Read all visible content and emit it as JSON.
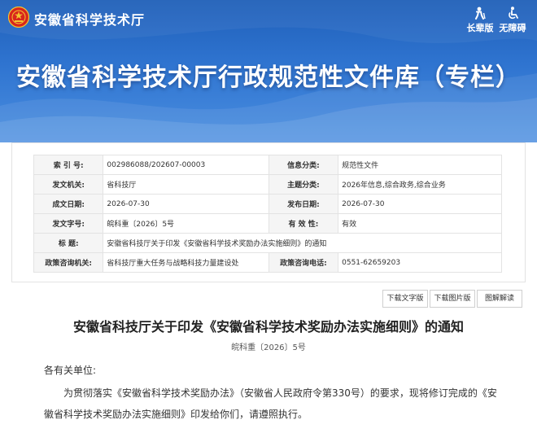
{
  "header": {
    "site_name": "安徽省科学技术厅",
    "elder_mode_label": "长辈版",
    "accessibility_label": "无障碍",
    "banner_title": "安徽省科学技术厅行政规范性文件库（专栏）"
  },
  "meta": {
    "rows": [
      {
        "k1": "索 引 号:",
        "v1": "002986088/202607-00003",
        "k2": "信息分类:",
        "v2": "规范性文件"
      },
      {
        "k1": "发文机关:",
        "v1": "省科技厅",
        "k2": "主题分类:",
        "v2": "2026年信息,综合政务,综合业务"
      },
      {
        "k1": "成文日期:",
        "v1": "2026-07-30",
        "k2": "发布日期:",
        "v2": "2026-07-30"
      },
      {
        "k1": "发文字号:",
        "v1": "皖科重〔2026〕5号",
        "k2": "有 效 性:",
        "v2": "有效"
      }
    ],
    "title_label": "标 题:",
    "title_value": "安徽省科技厅关于印发《安徽省科学技术奖励办法实施细则》的通知",
    "consult_org_label": "政策咨询机关:",
    "consult_org_value": "省科技厅重大任务与战略科技力量建设处",
    "consult_phone_label": "政策咨询电话:",
    "consult_phone_value": "0551-62659203"
  },
  "downloads": {
    "text_label": "下载文字版",
    "image_label": "下载图片版",
    "interpret_label": "图解解读"
  },
  "document": {
    "title": "安徽省科技厅关于印发《安徽省科学技术奖励办法实施细则》的通知",
    "number": "皖科重〔2026〕5号",
    "salutation": "各有关单位:",
    "paragraph": "为贯彻落实《安徽省科学技术奖励办法》（安徽省人民政府令第330号）的要求，现将修订完成的《安徽省科学技术奖励办法实施细则》印发给你们，请遵照执行。"
  },
  "colors": {
    "banner_dark": "#1f5fb8",
    "banner_light": "#4a8ee0",
    "emblem_red": "#d8261c",
    "emblem_gold": "#f4c430"
  }
}
